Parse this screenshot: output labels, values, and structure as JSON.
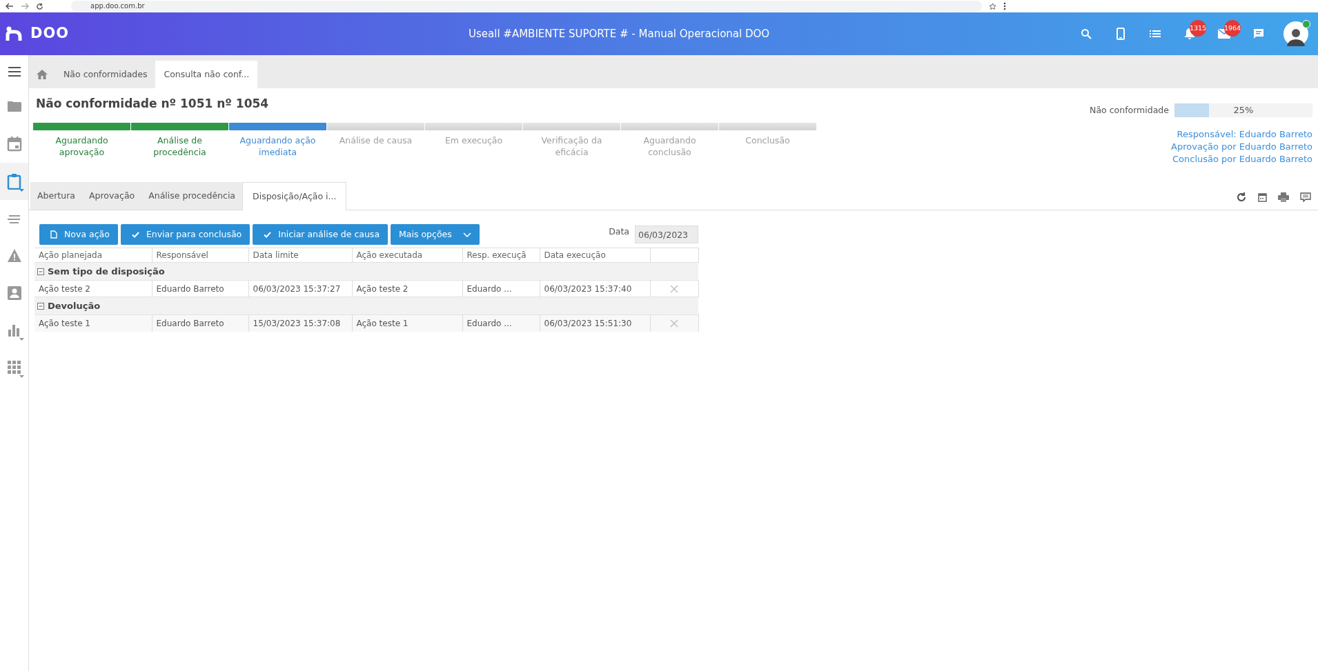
{
  "browser": {
    "url": "app.doo.com.br"
  },
  "header": {
    "logo": "DOO",
    "title": "Useall #AMBIENTE SUPORTE # - Manual Operacional DOO",
    "notifications": "1315",
    "messages": "1964",
    "online": true
  },
  "sidebar": {
    "items": [
      {
        "selected": false,
        "submenu": false
      },
      {
        "selected": false,
        "submenu": false
      },
      {
        "selected": true,
        "submenu": true
      },
      {
        "selected": false,
        "submenu": false
      },
      {
        "selected": false,
        "submenu": false
      },
      {
        "selected": false,
        "submenu": false
      },
      {
        "selected": false,
        "submenu": true
      },
      {
        "selected": false,
        "submenu": true
      }
    ]
  },
  "page_tabs": [
    {
      "label": "Não conformidades",
      "selected": false
    },
    {
      "label": "Consulta não conf...",
      "selected": true
    }
  ],
  "title": "Não conformidade nº 1051 nº 1054",
  "steps": [
    {
      "label": "Aguardando aprovação",
      "completed": true,
      "current": false
    },
    {
      "label": "Análise de procedência",
      "completed": true,
      "current": false
    },
    {
      "label": "Aguardando ação imediata",
      "completed": false,
      "current": true
    },
    {
      "label": "Análise de causa",
      "completed": false,
      "current": false
    },
    {
      "label": "Em execução",
      "completed": false,
      "current": false
    },
    {
      "label": "Verificação da eficácia",
      "completed": false,
      "current": false
    },
    {
      "label": "Aguardando conclusão",
      "completed": false,
      "current": false
    },
    {
      "label": "Conclusão",
      "completed": false,
      "current": false
    }
  ],
  "progress": {
    "label": "Não conformidade",
    "level": 0.25,
    "reading": "25%"
  },
  "links": [
    "Responsável: Eduardo Barreto",
    "Aprovação por Eduardo Barreto",
    "Conclusão por Eduardo Barreto"
  ],
  "tabs": [
    {
      "label": "Abertura",
      "selected": false
    },
    {
      "label": "Aprovação",
      "selected": false
    },
    {
      "label": "Análise procedência",
      "selected": false
    },
    {
      "label": "Disposição/Ação i...",
      "selected": true
    }
  ],
  "buttons": [
    {
      "label": "Nova ação",
      "kind": "new"
    },
    {
      "label": "Enviar para conclusão",
      "kind": "check"
    },
    {
      "label": "Iniciar análise de causa",
      "kind": "check"
    },
    {
      "label": "Mais opções",
      "kind": "dropdown"
    }
  ],
  "date_field": {
    "label": "Data",
    "value": "06/03/2023",
    "disabled": true
  },
  "table": {
    "columns": [
      "Ação planejada",
      "Responsável",
      "Data limite",
      "Ação executada",
      "Resp. execuçã",
      "Data execução"
    ],
    "groups": [
      {
        "name": "Sem tipo de disposição",
        "expanded": true,
        "rows": [
          [
            "Ação teste 2",
            "Eduardo Barreto",
            "06/03/2023 15:37:27",
            "Ação teste 2",
            "Eduardo ...",
            "06/03/2023 15:37:40"
          ]
        ]
      },
      {
        "name": "Devolução",
        "expanded": true,
        "rows": [
          [
            "Ação teste 1",
            "Eduardo Barreto",
            "15/03/2023 15:37:08",
            "Ação teste 1",
            "Eduardo ...",
            "06/03/2023 15:51:30"
          ]
        ]
      }
    ]
  }
}
